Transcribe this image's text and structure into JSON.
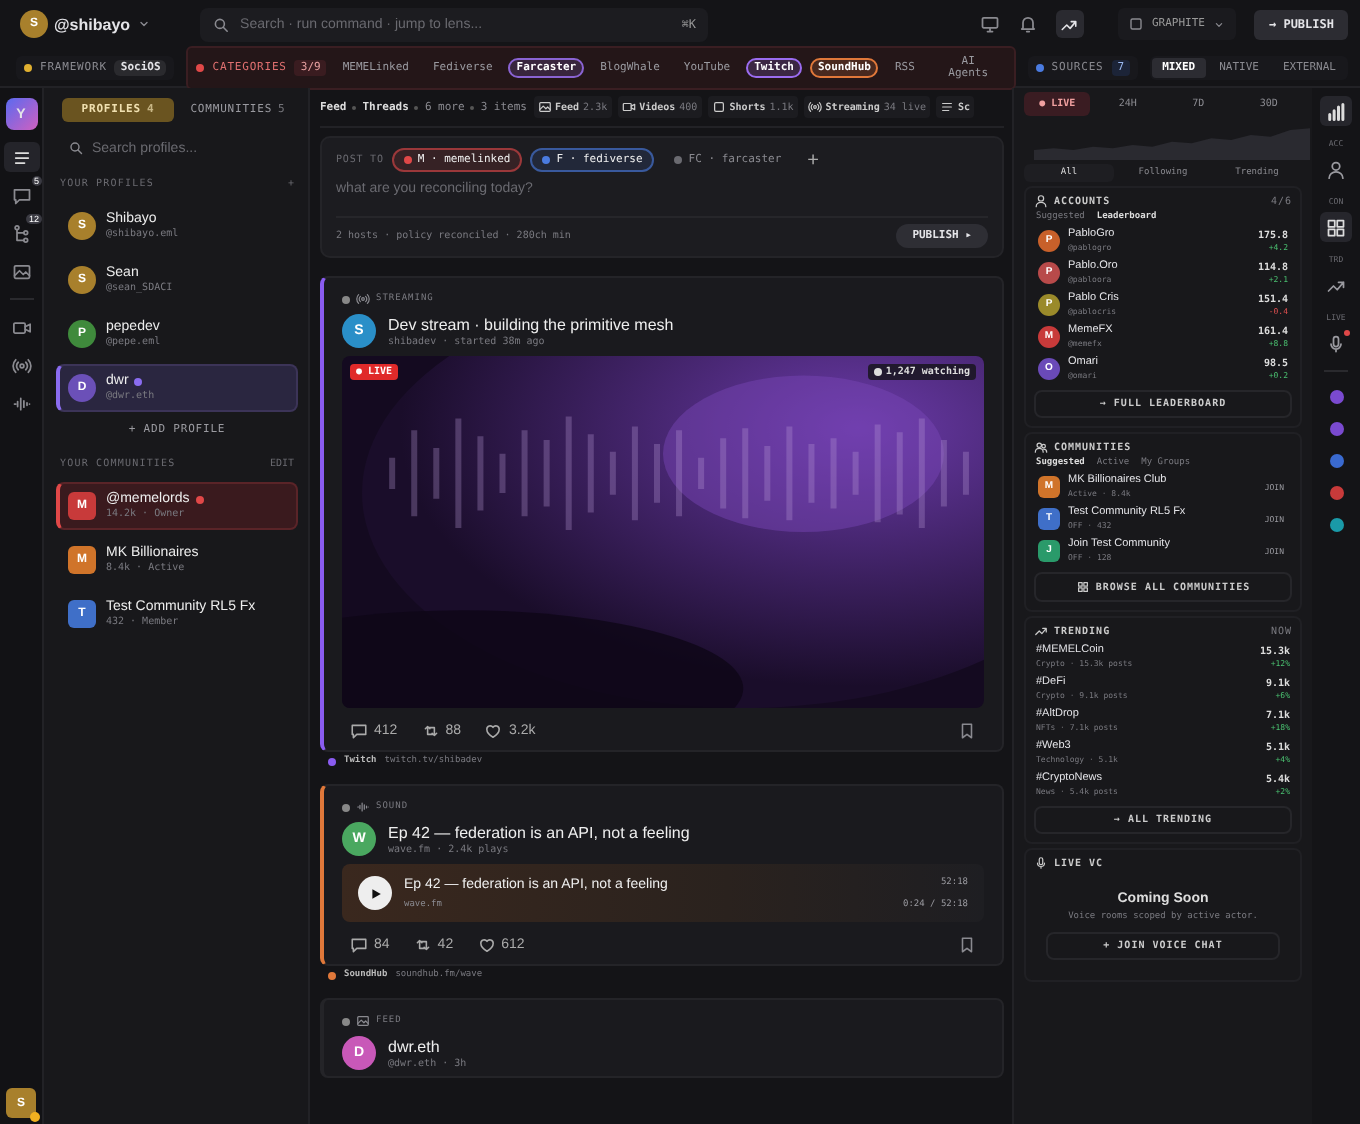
{
  "top_bar": {
    "user": {
      "initial": "S",
      "handle": "@shibayo"
    },
    "search": {
      "placeholder": "Search · run command · jump to lens...",
      "shortcut": "⌘K"
    },
    "workspace": "GRAPHITE",
    "publish": "→ PUBLISH"
  },
  "filter_bar": {
    "framework": {
      "label": "FRAMEWORK",
      "value": "SociOS"
    },
    "categories": {
      "label": "CATEGORIES",
      "count": "3/9",
      "items": [
        {
          "label": "MEMELinked",
          "selected": false
        },
        {
          "label": "Fediverse",
          "selected": false
        },
        {
          "label": "Farcaster",
          "selected": true,
          "color": "#8a63d2"
        },
        {
          "label": "BlogWhale",
          "selected": false
        },
        {
          "label": "YouTube",
          "selected": false
        },
        {
          "label": "Twitch",
          "selected": true,
          "color": "#9b6cf0"
        },
        {
          "label": "SoundHub",
          "selected": true,
          "color": "#e0783a"
        },
        {
          "label": "RSS",
          "selected": false
        },
        {
          "label": "AI Agents",
          "selected": false
        }
      ]
    },
    "sources": {
      "label": "SOURCES",
      "count": "7"
    },
    "modes": [
      {
        "label": "MIXED",
        "selected": true
      },
      {
        "label": "NATIVE",
        "selected": false
      },
      {
        "label": "EXTERNAL",
        "selected": false
      }
    ]
  },
  "rail": {
    "logo": "Y",
    "items": [
      {
        "selected": true
      },
      {
        "selected": false,
        "badge": "5"
      },
      {
        "selected": false,
        "badge": "12"
      },
      {
        "selected": false
      },
      {
        "selected": false
      },
      {
        "selected": false
      },
      {
        "selected": false
      }
    ],
    "user": {
      "initial": "S"
    }
  },
  "sidebar": {
    "tabs": [
      {
        "label": "PROFILES",
        "count": "4",
        "selected": true
      },
      {
        "label": "COMMUNITIES",
        "count": "5",
        "selected": false
      }
    ],
    "search": {
      "placeholder": "Search profiles..."
    },
    "profiles_heading": "YOUR PROFILES",
    "profiles_add": "+",
    "profiles": [
      {
        "initial": "S",
        "name": "Shibayo",
        "handle": "@shibayo.eml",
        "color": "#a8802c",
        "selected": false,
        "dot": false
      },
      {
        "initial": "S",
        "name": "Sean",
        "handle": "@sean_SDACI",
        "color": "#a8802c",
        "selected": false,
        "dot": false
      },
      {
        "initial": "P",
        "name": "pepedev",
        "handle": "@pepe.eml",
        "color": "#3f8a3c",
        "selected": false,
        "dot": false
      },
      {
        "initial": "D",
        "name": "dwr",
        "handle": "@dwr.eth",
        "color": "#6b50b8",
        "selected": true,
        "dot": true
      }
    ],
    "add_profile": "+ ADD PROFILE",
    "communities_heading": "YOUR COMMUNITIES",
    "communities_edit": "EDIT",
    "communities": [
      {
        "initial": "M",
        "name": "@memelords",
        "meta": "14.2k · Owner",
        "color": "#c83a3a",
        "selected": true,
        "dot": true
      },
      {
        "initial": "M",
        "name": "MK Billionaires",
        "meta": "8.4k · Active",
        "color": "#d0742a",
        "selected": false,
        "dot": false
      },
      {
        "initial": "T",
        "name": "Test Community RL5 Fx",
        "meta": "432 · Member",
        "color": "#3f6fc8",
        "selected": false,
        "dot": false
      }
    ]
  },
  "main": {
    "breadcrumb": [
      "Feed",
      "Threads",
      "6 more",
      "3 items"
    ],
    "lenses": [
      {
        "label": "Feed",
        "count": "2.3k"
      },
      {
        "label": "Videos",
        "count": "400"
      },
      {
        "label": "Shorts",
        "count": "1.1k"
      },
      {
        "label": "Streaming",
        "count": "34 live"
      },
      {
        "label": "Sc"
      }
    ],
    "composer": {
      "label": "POST TO",
      "targets": [
        {
          "label": "M · memelinked",
          "color": "#e04848",
          "selected": true
        },
        {
          "label": "F · fediverse",
          "color": "#4a7be0",
          "selected": true
        },
        {
          "label": "FC · farcaster",
          "color": "#6a6a70",
          "selected": false
        }
      ],
      "add": "+",
      "placeholder": "what are you reconciling today?",
      "status": "2 hosts · policy reconciled · 280ch min",
      "publish": "PUBLISH ▸"
    },
    "posts": [
      {
        "kind": "stream",
        "type_label": "STREAMING",
        "color": "#8a5cf0",
        "avatar": {
          "initial": "S",
          "color": "#2a8fc8"
        },
        "title": "Dev stream · building the primitive mesh",
        "meta": "shibadev · started 38m ago",
        "live_label": "● LIVE",
        "viewers": "1,247 watching",
        "actions": [
          {
            "kind": "comment",
            "count": "412"
          },
          {
            "kind": "repost",
            "count": "88"
          },
          {
            "kind": "like",
            "count": "3.2k"
          }
        ],
        "source": {
          "name": "Twitch",
          "url": "twitch.tv/shibadev"
        }
      },
      {
        "kind": "sound",
        "type_label": "SOUND",
        "color": "#e0783a",
        "avatar": {
          "initial": "W",
          "color": "#4aa860"
        },
        "title": "Ep 42 — federation is an API, not a feeling",
        "meta": "wave.fm · 2.4k plays",
        "player": {
          "title": "Ep 42 — federation is an API, not a feeling",
          "source": "wave.fm",
          "duration": "52:18",
          "position": "0:24 / 52:18"
        },
        "actions": [
          {
            "kind": "comment",
            "count": "84"
          },
          {
            "kind": "repost",
            "count": "42"
          },
          {
            "kind": "like",
            "count": "612"
          }
        ],
        "source": {
          "name": "SoundHub",
          "url": "soundhub.fm/wave"
        }
      },
      {
        "kind": "feed",
        "type_label": "FEED",
        "avatar": {
          "initial": "D",
          "color": "#c858b8"
        },
        "title": "dwr.eth",
        "meta": "@dwr.eth · 3h"
      }
    ]
  },
  "right_panel": {
    "ranges": [
      {
        "label": "● LIVE",
        "selected": true
      },
      {
        "label": "24H",
        "selected": false
      },
      {
        "label": "7D",
        "selected": false
      },
      {
        "label": "30D",
        "selected": false
      }
    ],
    "scopes": [
      {
        "label": "All",
        "selected": true
      },
      {
        "label": "Following",
        "selected": false
      },
      {
        "label": "Trending",
        "selected": false
      }
    ],
    "accounts": {
      "title": "ACCOUNTS",
      "count": "4/6",
      "tabs": [
        {
          "label": "Suggested",
          "selected": false
        },
        {
          "label": "Leaderboard",
          "selected": true
        }
      ],
      "items": [
        {
          "initial": "P",
          "name": "PabloGro",
          "handle": "@pablogro",
          "score": "175.8",
          "delta": "+4.2",
          "kind": "up",
          "color": "#c8602a"
        },
        {
          "initial": "P",
          "name": "Pablo.Oro",
          "handle": "@pabloora",
          "score": "114.8",
          "delta": "+2.1",
          "kind": "up",
          "color": "#b84a4a"
        },
        {
          "initial": "P",
          "name": "Pablo Cris",
          "handle": "@pablocris",
          "score": "151.4",
          "delta": "-0.4",
          "kind": "down",
          "color": "#9a8a2a"
        },
        {
          "initial": "M",
          "name": "MemeFX",
          "handle": "@memefx",
          "score": "161.4",
          "delta": "+8.8",
          "kind": "up",
          "color": "#c83a3a"
        },
        {
          "initial": "O",
          "name": "Omari",
          "handle": "@omari",
          "score": "98.5",
          "delta": "+0.2",
          "kind": "up",
          "color": "#6a4ab8"
        }
      ],
      "more": "→ FULL LEADERBOARD"
    },
    "communities": {
      "title": "COMMUNITIES",
      "tabs": [
        {
          "label": "Suggested",
          "selected": true
        },
        {
          "label": "Active",
          "selected": false
        },
        {
          "label": "My Groups",
          "selected": false
        }
      ],
      "items": [
        {
          "initial": "M",
          "name": "MK Billionaires Club",
          "meta": "Active · 8.4k",
          "action": "JOIN",
          "color": "#d0742a"
        },
        {
          "initial": "T",
          "name": "Test Community RL5 Fx",
          "meta": "OFF · 432",
          "action": "JOIN",
          "color": "#3f6fc8"
        },
        {
          "initial": "J",
          "name": "Join Test Community",
          "meta": "OFF · 128",
          "action": "JOIN",
          "color": "#2a9a6a"
        }
      ],
      "more": "BROWSE ALL COMMUNITIES"
    },
    "trending": {
      "title": "TRENDING",
      "badge": "NOW",
      "items": [
        {
          "tag": "#MEMELCoin",
          "meta": "Crypto · 15.3k posts",
          "count": "15.3k",
          "change": "+12%"
        },
        {
          "tag": "#DeFi",
          "meta": "Crypto · 9.1k posts",
          "count": "9.1k",
          "change": "+6%"
        },
        {
          "tag": "#AltDrop",
          "meta": "NFTs · 7.1k posts",
          "count": "7.1k",
          "change": "+18%"
        },
        {
          "tag": "#Web3",
          "meta": "Technology · 5.1k",
          "count": "5.1k",
          "change": "+4%"
        },
        {
          "tag": "#CryptoNews",
          "meta": "News · 5.4k posts",
          "count": "5.4k",
          "change": "+2%"
        }
      ],
      "more": "→ ALL TRENDING"
    },
    "live_vc": {
      "title": "LIVE VC",
      "heading": "Coming Soon",
      "text": "Voice rooms scoped by active actor.",
      "action": "+ JOIN VOICE CHAT"
    }
  },
  "right_rail": {
    "sections": [
      {
        "label": "ACC",
        "selected": false
      },
      {
        "label": "CON",
        "selected": true
      },
      {
        "label": "TRD",
        "selected": false
      },
      {
        "label": "LIVE",
        "selected": false,
        "alert": true
      }
    ],
    "dots": [
      {
        "color": "#7a4ad0"
      },
      {
        "color": "#7a4ad0"
      },
      {
        "color": "#3a6ad0"
      },
      {
        "color": "#c83a3a"
      },
      {
        "color": "#1a9aa8"
      }
    ]
  }
}
